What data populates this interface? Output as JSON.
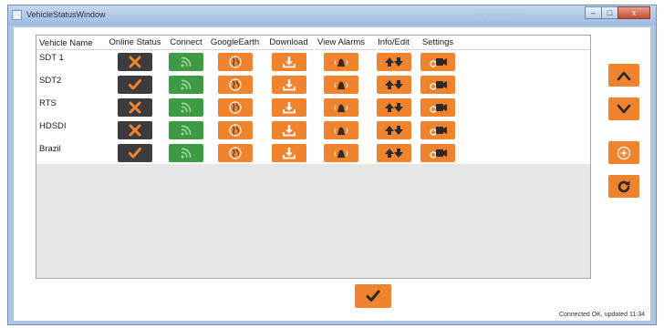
{
  "window": {
    "title": "VehicleStatusWindow",
    "blurred_title_text": "··· ········ ···",
    "controls": {
      "minimize": "–",
      "maximize": "□",
      "close": "x"
    }
  },
  "table": {
    "columns": [
      "Vehicle Name",
      "Online Status",
      "Connect",
      "GoogleEarth",
      "Download",
      "View Alarms",
      "Info/Edit",
      "Settings"
    ],
    "rows": [
      {
        "name": "SDT 1",
        "online": "offline"
      },
      {
        "name": "SDT2",
        "online": "online"
      },
      {
        "name": "RTS",
        "online": "offline"
      },
      {
        "name": "HDSDI",
        "online": "offline"
      },
      {
        "name": "Brazil",
        "online": "online"
      }
    ],
    "icons": {
      "offline": "x-icon",
      "online": "check-icon",
      "connect": "signal-icon",
      "googleearth": "globe-icon",
      "download": "download-icon",
      "alarms": "alarm-bell-icon",
      "info": "up-down-arrows-icon",
      "settings": "camera-settings-icon"
    }
  },
  "side_buttons": [
    "chevron-up-icon",
    "chevron-down-icon",
    "plus-circle-icon",
    "refresh-icon"
  ],
  "ok_button": "check-icon",
  "status_text": "Connected OK, updated 11:34",
  "colors": {
    "accent": "#f0832e",
    "dark_button": "#3c3c3e",
    "connect_green": "#3e9a43",
    "title_bar": "#aec6e4"
  }
}
